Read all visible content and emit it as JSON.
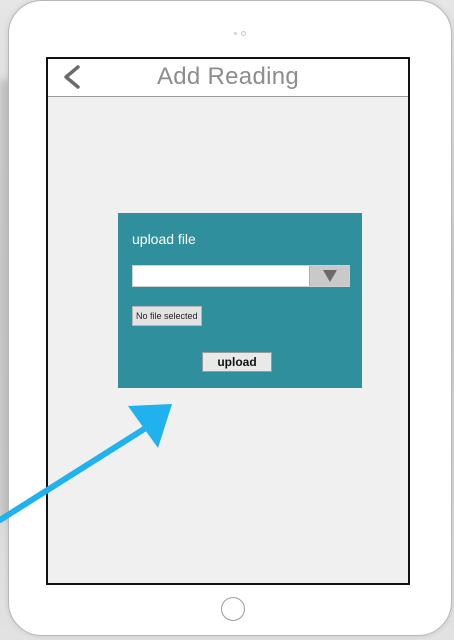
{
  "nav": {
    "title": "Add Reading",
    "back_icon": "chevron-left-icon"
  },
  "upload_panel": {
    "title": "upload file",
    "select_value": "",
    "dropdown_icon": "triangle-down-icon",
    "file_chooser_label": "No file selected",
    "upload_button_label": "upload"
  },
  "colors": {
    "panel_background": "#2f8f9d",
    "screen_background": "#f0f0f0",
    "annotation_arrow": "#1fb2ee",
    "title_text": "#8d8d8d"
  },
  "annotation": {
    "arrow_icon": "pointer-arrow-icon"
  }
}
